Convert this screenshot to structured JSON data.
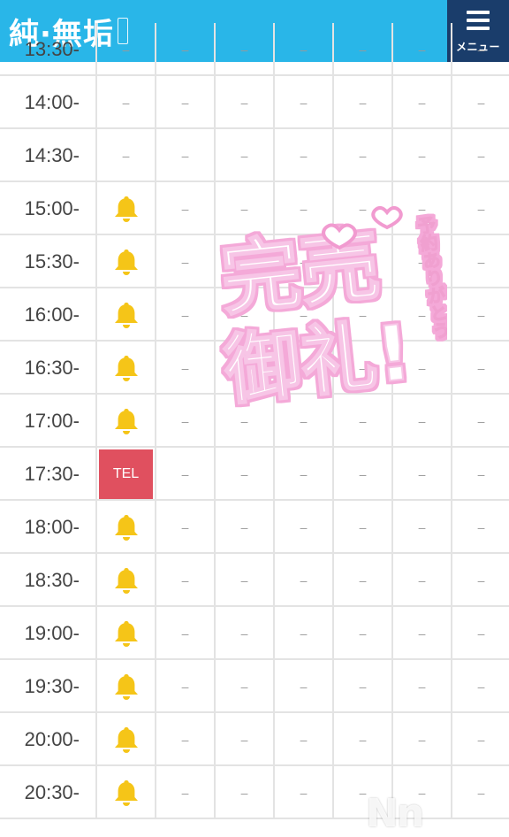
{
  "header": {
    "logo_text": "純·無垢",
    "menu_label": "メニュー",
    "accent_color": "#29b6e8",
    "menu_bg_color": "#1a3d6b"
  },
  "schedule": {
    "empty_mark": "–",
    "tel_label": "TEL",
    "tel_color": "#e0505f",
    "bell_color": "#f5c518",
    "rows": [
      {
        "time": "13:30-",
        "first": "dash"
      },
      {
        "time": "14:00-",
        "first": "dash"
      },
      {
        "time": "14:30-",
        "first": "dash"
      },
      {
        "time": "15:00-",
        "first": "bell"
      },
      {
        "time": "15:30-",
        "first": "bell"
      },
      {
        "time": "16:00-",
        "first": "bell"
      },
      {
        "time": "16:30-",
        "first": "bell"
      },
      {
        "time": "17:00-",
        "first": "bell"
      },
      {
        "time": "17:30-",
        "first": "tel"
      },
      {
        "time": "18:00-",
        "first": "bell"
      },
      {
        "time": "18:30-",
        "first": "bell"
      },
      {
        "time": "19:00-",
        "first": "bell"
      },
      {
        "time": "19:30-",
        "first": "bell"
      },
      {
        "time": "20:00-",
        "first": "bell"
      },
      {
        "time": "20:30-",
        "first": "bell"
      }
    ]
  },
  "overlay": {
    "big_text_line1": "完売",
    "big_text_line2": "御礼!",
    "side_text": "予約ありがとう"
  },
  "watermark": "Nn"
}
